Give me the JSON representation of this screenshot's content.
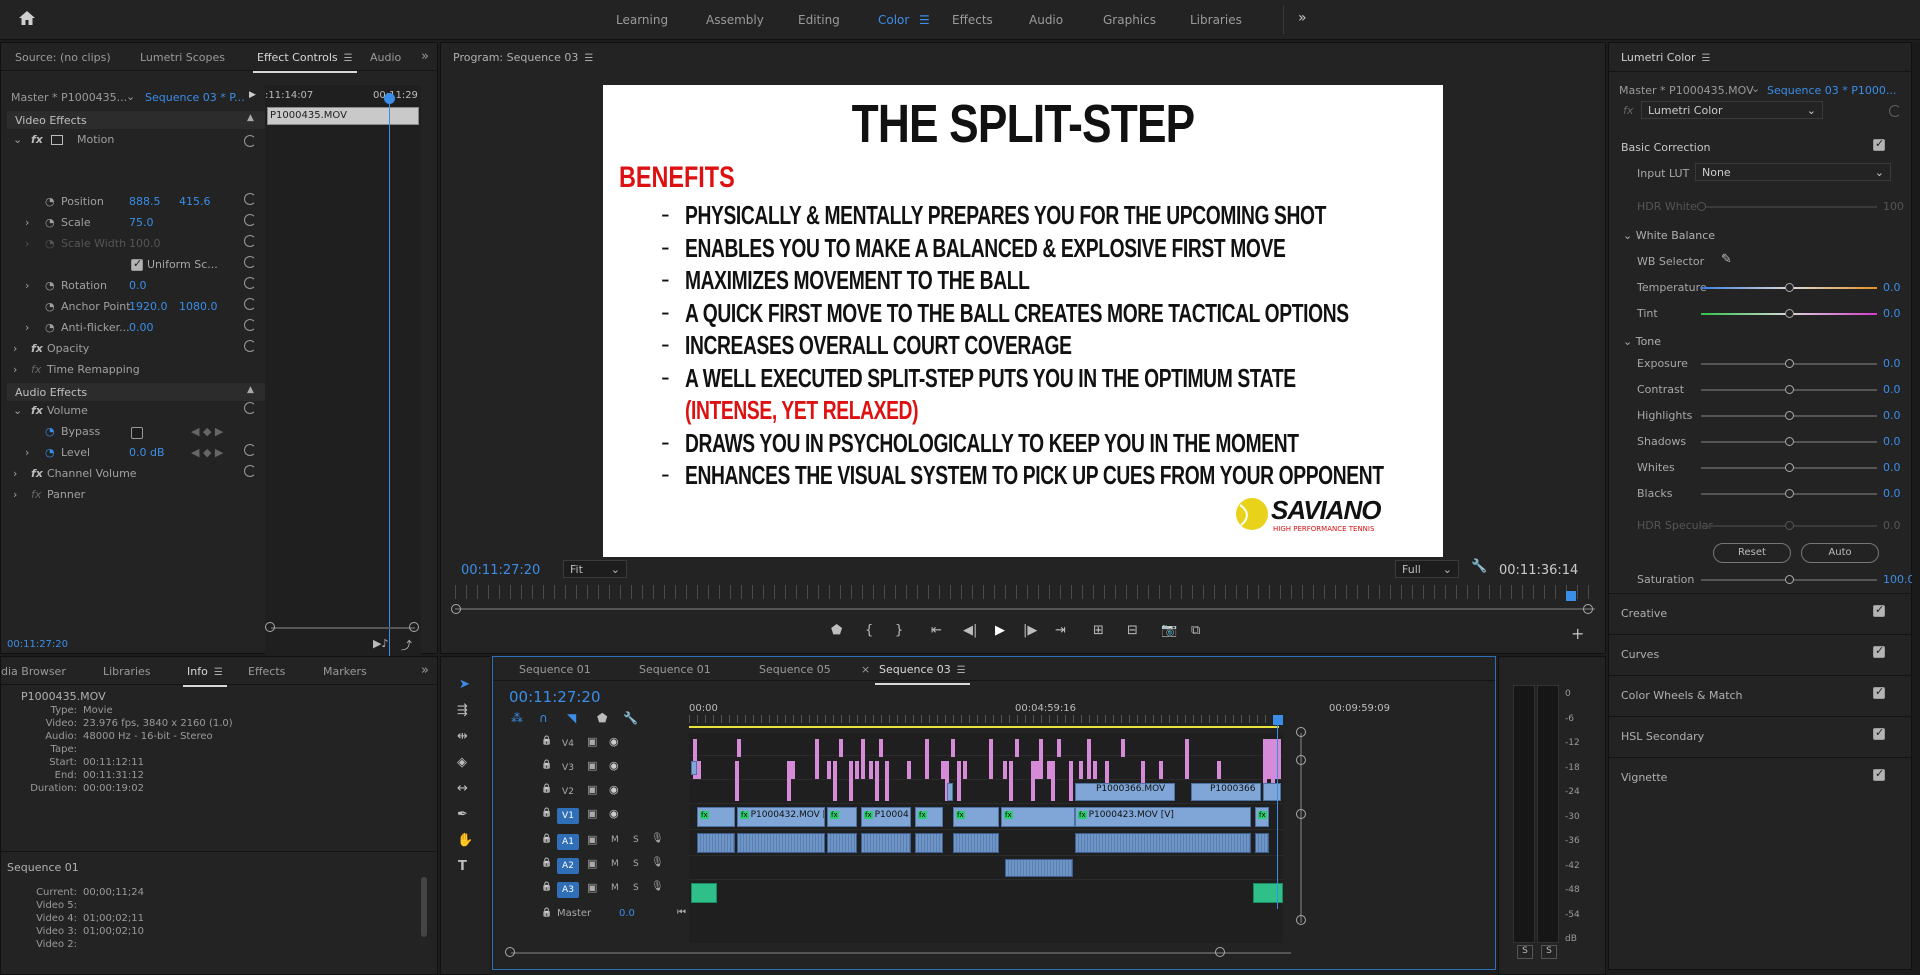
{
  "workspaces": {
    "items": [
      "Learning",
      "Assembly",
      "Editing",
      "Color",
      "Effects",
      "Audio",
      "Graphics",
      "Libraries"
    ],
    "active": "Color"
  },
  "source_panel": {
    "tabs": [
      "Source: (no clips)",
      "Lumetri Scopes",
      "Effect Controls",
      "Audio"
    ],
    "master_label": "Master * P1000435...",
    "sequence_label": "Sequence 03 * P...",
    "mini_tc_start": ":11:14:07",
    "mini_tc_end": "00:11:29",
    "clip_name": "P1000435.MOV",
    "video_effects": "Video Effects",
    "motion": "Motion",
    "position_label": "Position",
    "position_x": "888.5",
    "position_y": "415.6",
    "scale_label": "Scale",
    "scale_value": "75.0",
    "scale_width_label": "Scale Width",
    "scale_width_value": "100.0",
    "uniform_label": "Uniform Sc...",
    "rotation_label": "Rotation",
    "rotation_value": "0.0",
    "anchor_label": "Anchor Point",
    "anchor_x": "1920.0",
    "anchor_y": "1080.0",
    "antiflicker_label": "Anti-flicker...",
    "antiflicker_value": "0.00",
    "opacity": "Opacity",
    "time_remap": "Time Remapping",
    "audio_effects": "Audio Effects",
    "volume": "Volume",
    "bypass_label": "Bypass",
    "level_label": "Level",
    "level_value": "0.0 dB",
    "channel_volume": "Channel Volume",
    "panner": "Panner",
    "bottom_tc": "00:11:27:20"
  },
  "info_panel": {
    "tabs": [
      "dia Browser",
      "Libraries",
      "Info",
      "Effects",
      "Markers"
    ],
    "clip_name": "P1000435.MOV",
    "rows": [
      {
        "k": "Type:",
        "v": "Movie"
      },
      {
        "k": "Video:",
        "v": "23.976 fps, 3840 x 2160 (1.0)"
      },
      {
        "k": "Audio:",
        "v": "48000 Hz - 16-bit - Stereo"
      },
      {
        "k": "Tape:",
        "v": ""
      },
      {
        "k": "Start:",
        "v": "00:11:12:11"
      },
      {
        "k": "End:",
        "v": "00:11:31:12"
      },
      {
        "k": "Duration:",
        "v": "00:00:19:02"
      }
    ],
    "sequence_title": "Sequence 01",
    "seq_rows": [
      {
        "k": "Current:",
        "v": "00;00;11;24"
      },
      {
        "k": "Video 5:",
        "v": ""
      },
      {
        "k": "Video 4:",
        "v": "01;00;02;11"
      },
      {
        "k": "Video 3:",
        "v": "01;00;02;10"
      },
      {
        "k": "Video 2:",
        "v": ""
      }
    ]
  },
  "program": {
    "title": "Program: Sequence 03",
    "slide_title": "THE SPLIT-STEP",
    "slide_heading": "BENEFITS",
    "bullets": [
      "PHYSICALLY & MENTALLY PREPARES YOU FOR THE UPCOMING SHOT",
      "ENABLES YOU TO MAKE A BALANCED & EXPLOSIVE FIRST MOVE",
      "MAXIMIZES MOVEMENT TO THE BALL",
      "A QUICK FIRST MOVE TO THE BALL CREATES MORE TACTICAL OPTIONS",
      "INCREASES OVERALL COURT COVERAGE",
      "A WELL EXECUTED SPLIT-STEP PUTS YOU IN THE OPTIMUM STATE"
    ],
    "bullet_red": "(INTENSE, YET RELAXED)",
    "bullets2": [
      "DRAWS YOU IN PSYCHOLOGICALLY TO KEEP YOU IN THE MOMENT",
      "ENHANCES THE VISUAL SYSTEM TO PICK UP CUES FROM YOUR OPPONENT"
    ],
    "logo_name": "SAVIANO",
    "logo_sub": "HIGH PERFORMANCE TENNIS",
    "current_tc": "00:11:27:20",
    "fit": "Fit",
    "quality": "Full",
    "duration_tc": "00:11:36:14"
  },
  "timeline": {
    "tabs": [
      "Sequence 01",
      "Sequence 01",
      "Sequence 05",
      "Sequence 03"
    ],
    "active_tab": "Sequence 03",
    "timecode": "00:11:27:20",
    "ruler": [
      "00:00",
      "00:04:59:16",
      "00:09:59:09"
    ],
    "tracks": [
      "V4",
      "V3",
      "V2",
      "V1",
      "A1",
      "A2",
      "A3"
    ],
    "master": "Master",
    "master_val": "0.0",
    "clips": {
      "c1": "P1000432.MOV [V",
      "c2": "P10004",
      "c3": "P1000366.MOV",
      "c4": "P1000366",
      "c5": "P1000423.MOV [V]"
    },
    "meter_labels": [
      "0",
      "-6",
      "-12",
      "-18",
      "-24",
      "-30",
      "-36",
      "-42",
      "-48",
      "-54",
      "dB"
    ],
    "solo": [
      "S",
      "S"
    ]
  },
  "lumetri": {
    "title": "Lumetri Color",
    "master": "Master * P1000435.MOV",
    "sequence": "Sequence 03 * P1000...",
    "fx_name": "Lumetri Color",
    "basic": "Basic Correction",
    "input_lut_label": "Input LUT",
    "input_lut": "None",
    "hdr_white": "HDR White",
    "hdr_white_val": "100",
    "white_balance": "White Balance",
    "wb_selector": "WB Selector",
    "temperature": "Temperature",
    "tint": "Tint",
    "tone": "Tone",
    "tone_rows": [
      "Exposure",
      "Contrast",
      "Highlights",
      "Shadows",
      "Whites",
      "Blacks"
    ],
    "hdr_specular": "HDR Specular",
    "reset": "Reset",
    "auto": "Auto",
    "saturation": "Saturation",
    "saturation_val": "100.0",
    "zero": "0.0",
    "sections": [
      "Creative",
      "Curves",
      "Color Wheels & Match",
      "HSL Secondary",
      "Vignette"
    ]
  }
}
